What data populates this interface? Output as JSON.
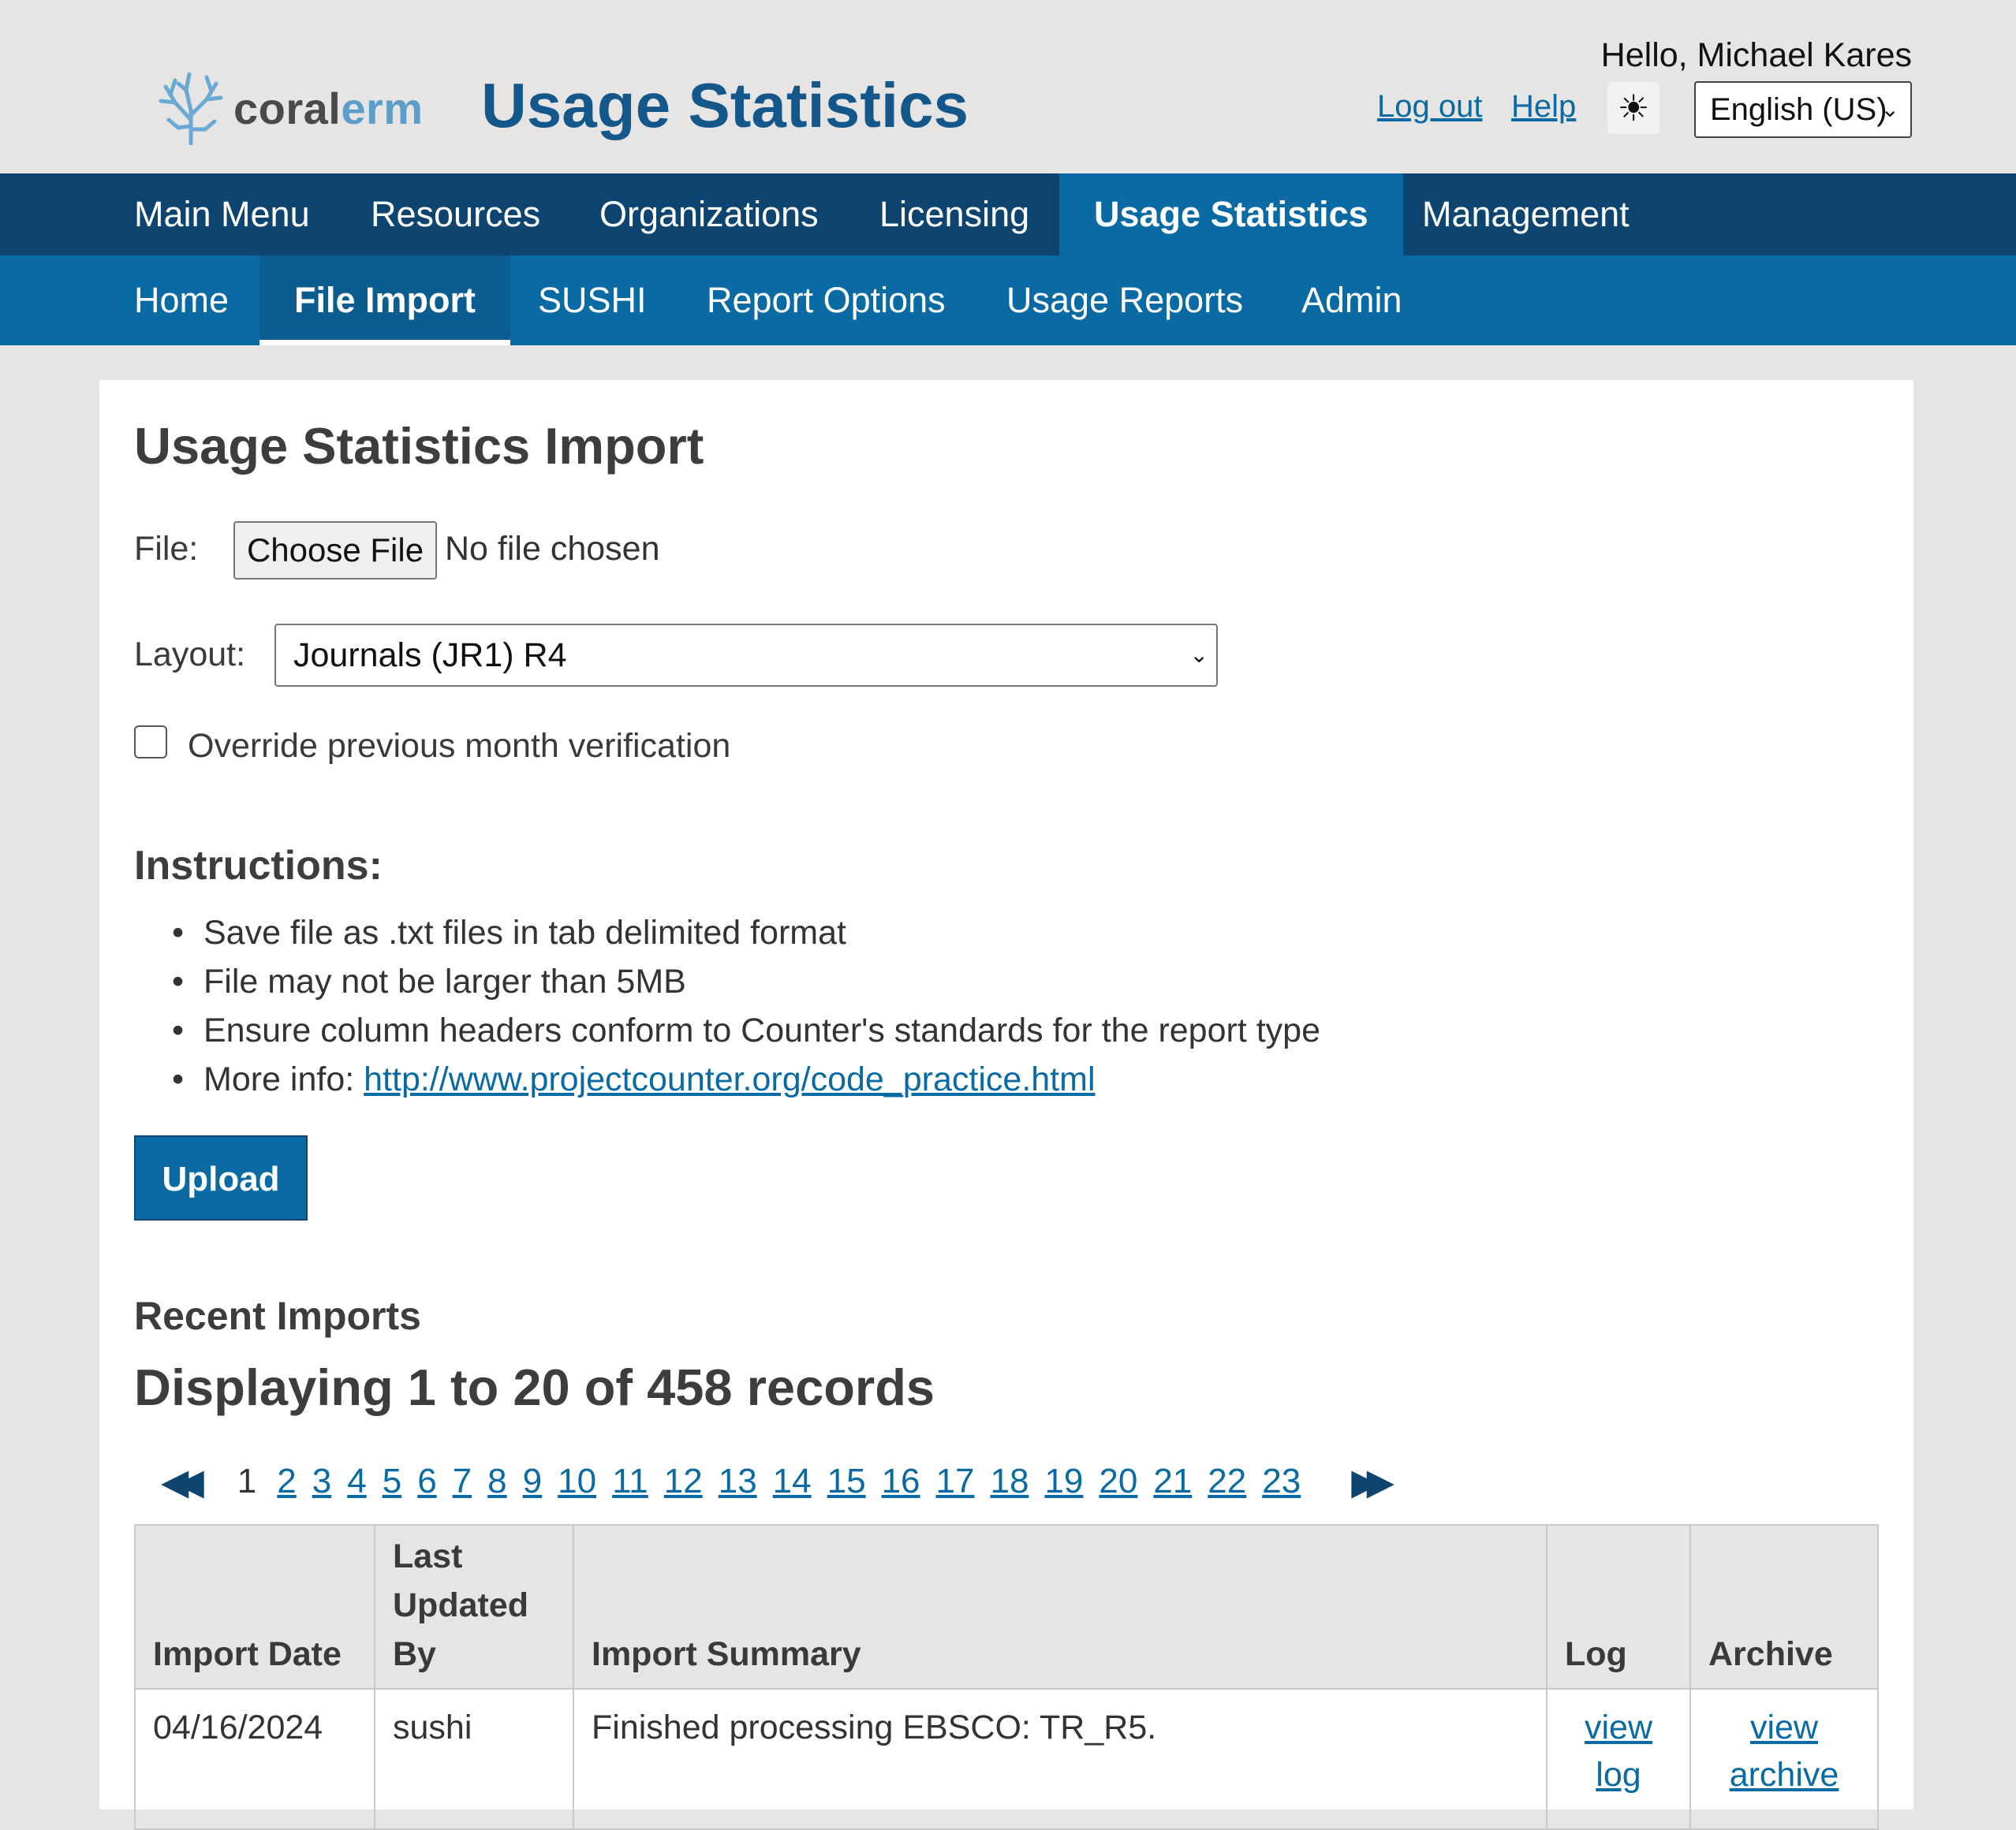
{
  "header": {
    "logo_text_a": "coral",
    "logo_text_b": "erm",
    "title": "Usage Statistics",
    "greeting": "Hello, Michael Kares",
    "logout": "Log out",
    "help": "Help",
    "theme_icon": "☀",
    "language": "English (US)"
  },
  "nav": {
    "main": [
      {
        "label": "Main Menu"
      },
      {
        "label": "Resources"
      },
      {
        "label": "Organizations"
      },
      {
        "label": "Licensing"
      },
      {
        "label": "Usage Statistics",
        "active": true
      },
      {
        "label": "Management"
      }
    ],
    "sub": [
      {
        "label": "Home"
      },
      {
        "label": "File Import",
        "active": true
      },
      {
        "label": "SUSHI"
      },
      {
        "label": "Report Options"
      },
      {
        "label": "Usage Reports"
      },
      {
        "label": "Admin"
      }
    ]
  },
  "form": {
    "page_title": "Usage Statistics Import",
    "file_label": "File:",
    "choose_file": "Choose File",
    "file_status": "No file chosen",
    "layout_label": "Layout:",
    "layout_value": "Journals (JR1) R4",
    "override_label": "Override previous month verification",
    "override_checked": false,
    "instructions_heading": "Instructions:",
    "instructions": [
      "Save file as .txt files in tab delimited format",
      "File may not be larger than 5MB",
      "Ensure column headers conform to Counter's standards for the report type"
    ],
    "more_info_label": "More info: ",
    "more_info_link": "http://www.projectcounter.org/code_practice.html",
    "upload": "Upload"
  },
  "recent": {
    "heading": "Recent Imports",
    "displaying": "Displaying 1 to 20 of 458 records",
    "current_page": "1",
    "pages": [
      "2",
      "3",
      "4",
      "5",
      "6",
      "7",
      "8",
      "9",
      "10",
      "11",
      "12",
      "13",
      "14",
      "15",
      "16",
      "17",
      "18",
      "19",
      "20",
      "21",
      "22",
      "23"
    ],
    "first_icon": "double-left-arrow",
    "last_icon": "double-right-arrow",
    "columns": {
      "import_date": "Import Date",
      "updated_by": "Last Updated By",
      "summary": "Import Summary",
      "log": "Log",
      "archive": "Archive"
    },
    "rows": [
      {
        "import_date": "04/16/2024",
        "updated_by": "sushi",
        "summary": "Finished processing EBSCO: TR_R5.",
        "log": "view log",
        "archive": "view archive"
      }
    ]
  },
  "colors": {
    "nav_dark": "#0d4570",
    "nav_blue": "#0a6aa3",
    "title_blue": "#14578a",
    "page_bg": "#e6e5e4"
  }
}
